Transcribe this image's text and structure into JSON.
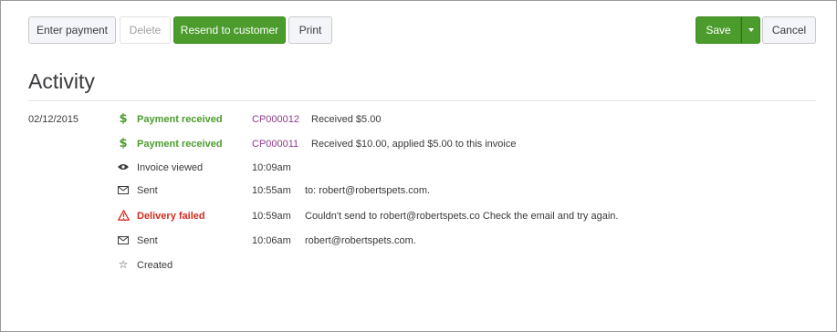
{
  "toolbar": {
    "enter_payment": "Enter payment",
    "delete": "Delete",
    "resend": "Resend to customer",
    "print": "Print",
    "save": "Save",
    "cancel": "Cancel"
  },
  "activity": {
    "title": "Activity",
    "date": "02/12/2015",
    "rows": [
      {
        "icon": "dollar-icon",
        "event": "Payment received",
        "ref": "CP000012",
        "detail": "Received $5.00"
      },
      {
        "icon": "dollar-icon",
        "event": "Payment received",
        "ref": "CP000011",
        "detail": "Received $10.00, applied $5.00 to this invoice"
      },
      {
        "icon": "eye-icon",
        "event": "Invoice viewed",
        "time": "10:09am"
      },
      {
        "icon": "envelope-icon",
        "event": "Sent",
        "time": "10:55am",
        "detail": "to:  robert@robertspets.com."
      },
      {
        "icon": "warning-icon",
        "event": "Delivery failed",
        "time": "10:59am",
        "detail": "Couldn't send to  robert@robertspets.co  Check the email and try again."
      },
      {
        "icon": "envelope-icon",
        "event": "Sent",
        "time": "10:06am",
        "detail": "robert@robertspets.com."
      },
      {
        "icon": "star-icon",
        "event": "Created"
      }
    ]
  },
  "colors": {
    "accent_green": "#4b9c2d",
    "error_red": "#d52b1e",
    "link_purple": "#8e3a8a"
  }
}
